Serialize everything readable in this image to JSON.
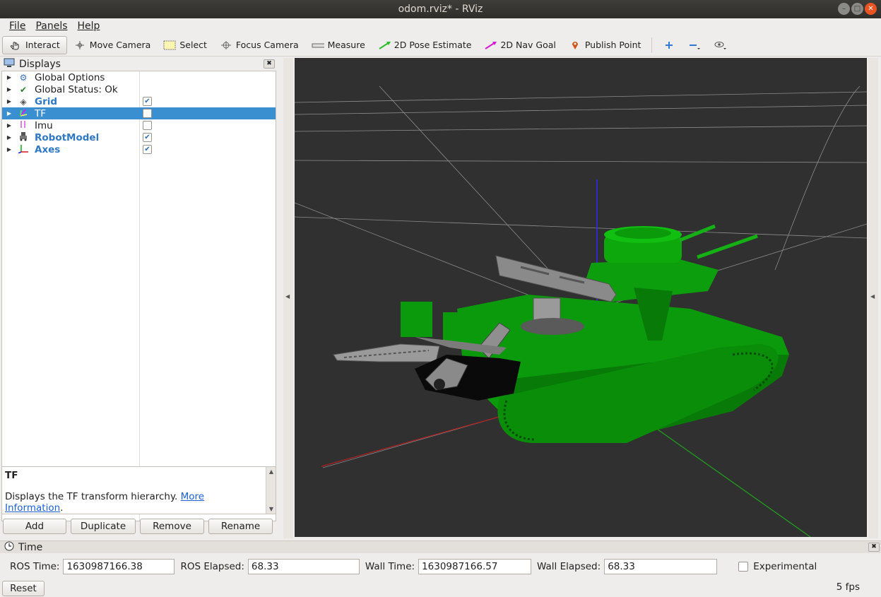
{
  "window": {
    "title": "odom.rviz* - RViz"
  },
  "menu": [
    {
      "label": "File"
    },
    {
      "label": "Panels"
    },
    {
      "label": "Help"
    }
  ],
  "toolbar": {
    "interact": "Interact",
    "move_camera": "Move Camera",
    "select": "Select",
    "focus_camera": "Focus Camera",
    "measure": "Measure",
    "pose_estimate": "2D Pose Estimate",
    "nav_goal": "2D Nav Goal",
    "publish_point": "Publish Point"
  },
  "displays": {
    "title": "Displays",
    "items": [
      {
        "label": "Global Options",
        "icon": "gear-icon"
      },
      {
        "label": "Global Status: Ok",
        "icon": "checkmark-icon"
      },
      {
        "label": "Grid",
        "icon": "grid-icon",
        "checked": true
      },
      {
        "label": "TF",
        "icon": "tf-icon",
        "checked": false,
        "selected": true
      },
      {
        "label": "Imu",
        "icon": "imu-icon",
        "checked": false
      },
      {
        "label": "RobotModel",
        "icon": "robot-icon",
        "checked": true
      },
      {
        "label": "Axes",
        "icon": "axes-icon",
        "checked": true
      }
    ],
    "description": {
      "title": "TF",
      "text": "Displays the TF transform hierarchy.",
      "link": "More Information",
      "tail": "."
    },
    "buttons": {
      "add": "Add",
      "duplicate": "Duplicate",
      "remove": "Remove",
      "rename": "Rename"
    }
  },
  "time": {
    "title": "Time",
    "ros_time_label": "ROS Time:",
    "ros_time": "1630987166.38",
    "ros_elapsed_label": "ROS Elapsed:",
    "ros_elapsed": "68.33",
    "wall_time_label": "Wall Time:",
    "wall_time": "1630987166.57",
    "wall_elapsed_label": "Wall Elapsed:",
    "wall_elapsed": "68.33",
    "experimental_label": "Experimental",
    "experimental": false
  },
  "status": {
    "reset": "Reset",
    "fps": "5 fps"
  },
  "colors": {
    "viewport_bg": "#303030",
    "robot": "#0a9e0a",
    "selection": "#3a8fd0"
  }
}
